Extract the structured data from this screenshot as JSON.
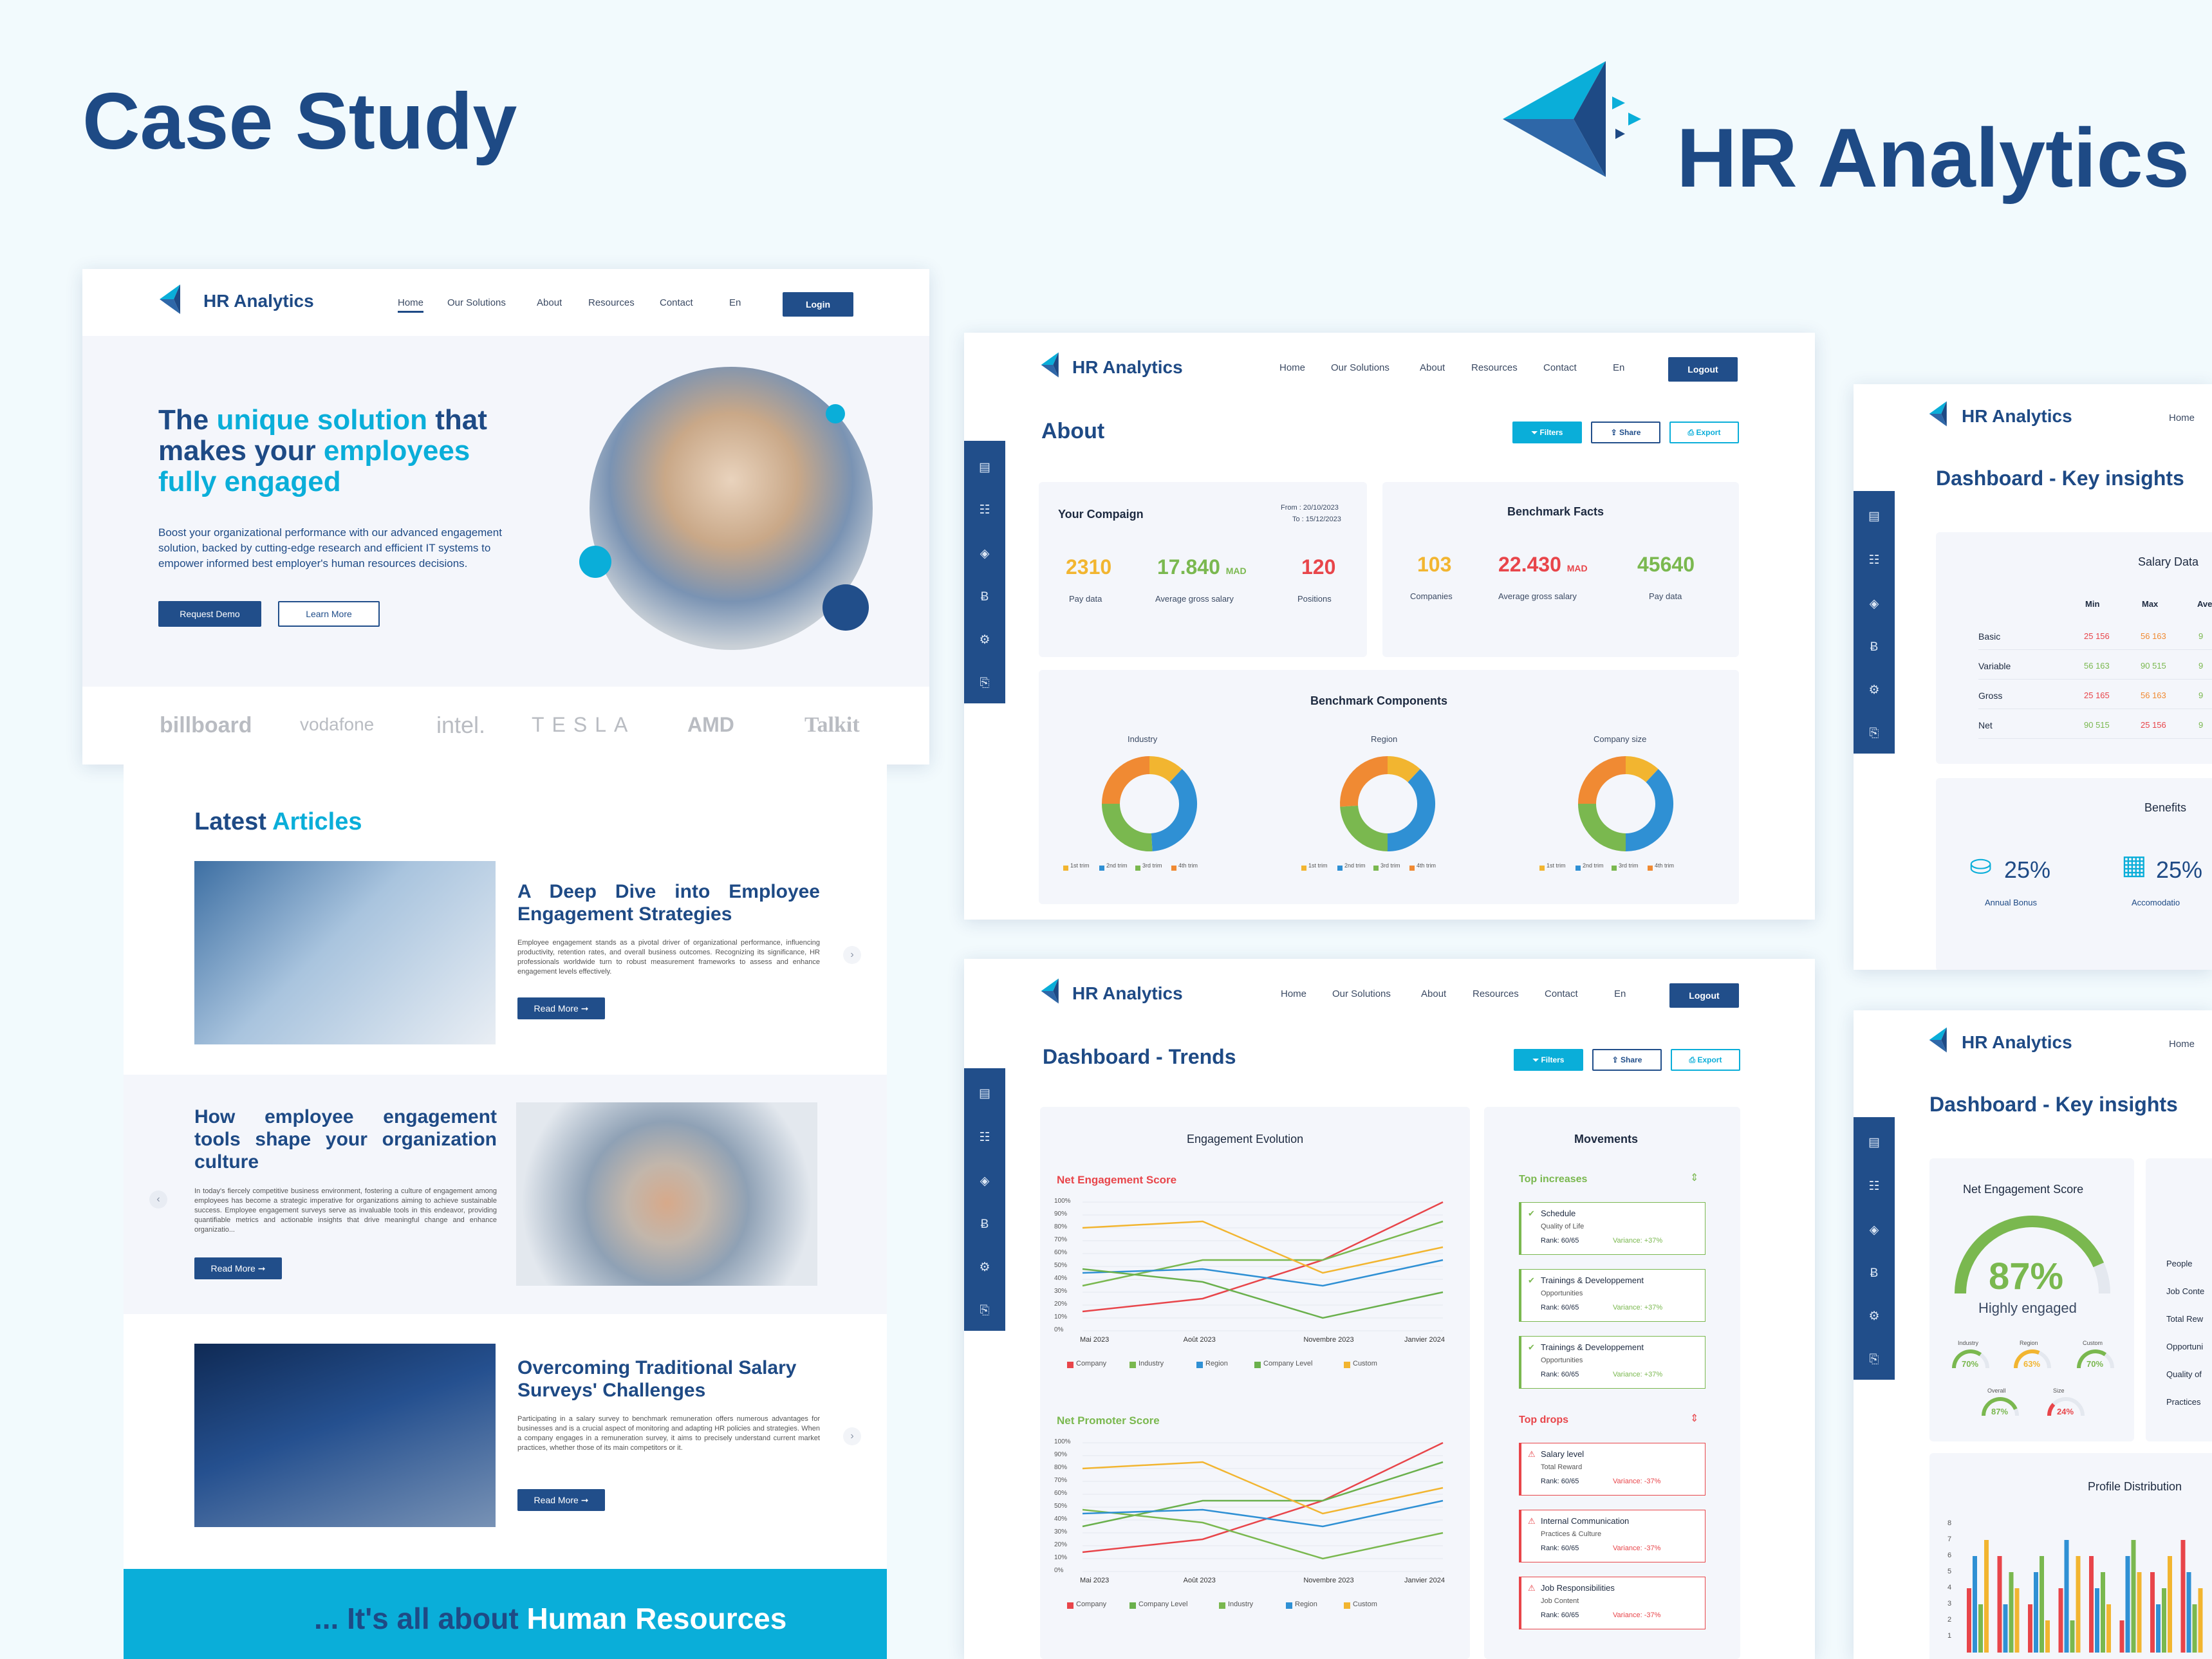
{
  "header": {
    "title": "Case Study",
    "brand": "HR Analytics"
  },
  "colors": {
    "navy": "#214e8a",
    "accent": "#0aaed9",
    "orange": "#f08a33",
    "green": "#7ab84f",
    "red": "#e8454a",
    "yellow": "#f2b530",
    "blue": "#2f90d4"
  },
  "nav": {
    "home": "Home",
    "solutions": "Our Solutions",
    "about": "About",
    "resources": "Resources",
    "contact": "Contact",
    "lang": "En",
    "login": "Login",
    "logout": "Logout"
  },
  "landing": {
    "hero_a": "The ",
    "hero_b": "unique solution",
    "hero_c": " that",
    "hero_d": "makes your ",
    "hero_e": "employees",
    "hero_f": "fully engaged",
    "hero_text": "Boost your organizational performance with our advanced engagement solution, backed by cutting-edge research and efficient IT systems to empower informed best employer's human resources decisions.",
    "request_demo": "Request Demo",
    "learn_more": "Learn More",
    "logos": [
      "billboard",
      "vodafone",
      "intel.",
      "TESLA",
      "AMD",
      "Talkit"
    ]
  },
  "articles": {
    "heading_a": "Latest ",
    "heading_b": "Articles",
    "read_more": "Read More",
    "items": [
      {
        "title": "A Deep Dive into Employee Engagement Strategies",
        "text": "Employee engagement stands as a pivotal driver of organizational performance, influencing productivity, retention rates, and overall business outcomes. Recognizing its significance, HR professionals worldwide turn to robust measurement frameworks to assess and enhance engagement levels effectively."
      },
      {
        "title": "How employee engagement tools shape your organization culture",
        "text": "In today's fiercely competitive business environment, fostering a culture of engagement among employees has become a strategic imperative for organizations aiming to achieve sustainable success. Employee engagement surveys serve as invaluable tools in this endeavor, providing quantifiable metrics and actionable insights that drive meaningful change and enhance organizatio..."
      },
      {
        "title": "Overcoming Traditional Salary Surveys' Challenges",
        "text": "Participating in a salary survey to benchmark remuneration offers numerous advantages for businesses and is a crucial aspect of monitoring and adapting HR policies and strategies. When a company engages in a remuneration survey, it aims to precisely understand current market practices, whether those of its main competitors or it."
      }
    ],
    "banner_a": "... It's all about ",
    "banner_b": "Human Resources"
  },
  "about_page": {
    "title": "About",
    "filters": "Filters",
    "share": "Share",
    "export": "Export",
    "campaign": {
      "label": "Your Compaign",
      "from": "From : 20/10/2023",
      "to": "To : 15/12/2023",
      "stats": [
        {
          "value": "2310",
          "unit": "",
          "label": "Pay data"
        },
        {
          "value": "17.840",
          "unit": "MAD",
          "label": "Average gross salary"
        },
        {
          "value": "120",
          "unit": "",
          "label": "Positions"
        }
      ]
    },
    "benchmark": {
      "label": "Benchmark Facts",
      "stats": [
        {
          "value": "103",
          "unit": "",
          "label": "Companies"
        },
        {
          "value": "22.430",
          "unit": "MAD",
          "label": "Average gross salary"
        },
        {
          "value": "45640",
          "unit": "",
          "label": "Pay data"
        }
      ]
    },
    "components": {
      "label": "Benchmark Components",
      "charts": [
        "Industry",
        "Region",
        "Company size"
      ],
      "legend": [
        "1st trim",
        "2nd trim",
        "3rd trim",
        "4th trim"
      ]
    }
  },
  "trends_page": {
    "title": "Dashboard - Trends",
    "engagement_title": "Engagement Evolution",
    "nes_title": "Net Engagement Score",
    "nps_title": "Net Promoter Score",
    "x_ticks": [
      "Mai 2023",
      "Août 2023",
      "Novembre 2023",
      "Janvier 2024"
    ],
    "y_ticks": [
      "100%",
      "90%",
      "80%",
      "70%",
      "60%",
      "50%",
      "40%",
      "30%",
      "20%",
      "10%",
      "0%"
    ],
    "legend1": [
      "Company",
      "Industry",
      "Region",
      "Company Level",
      "Custom"
    ],
    "legend2": [
      "Company",
      "Company Level",
      "Industry",
      "Region",
      "Custom"
    ],
    "movements": {
      "title": "Movements",
      "increases": "Top increases",
      "drops": "Top drops",
      "up": [
        {
          "name": "Schedule",
          "sub": "Quality of Life",
          "rank": "Rank: 60/65",
          "variance": "Variance: +37%"
        },
        {
          "name": "Trainings & Developpement",
          "sub": "Opportunities",
          "rank": "Rank: 60/65",
          "variance": "Variance: +37%"
        },
        {
          "name": "Trainings & Developpement",
          "sub": "Opportunities",
          "rank": "Rank: 60/65",
          "variance": "Variance: +37%"
        }
      ],
      "down": [
        {
          "name": "Salary level",
          "sub": "Total Reward",
          "rank": "Rank: 60/65",
          "variance": "Variance: -37%"
        },
        {
          "name": "Internal Communication",
          "sub": "Practices & Culture",
          "rank": "Rank: 60/65",
          "variance": "Variance: -37%"
        },
        {
          "name": "Job Responsibilities",
          "sub": "Job Content",
          "rank": "Rank: 60/65",
          "variance": "Variance: -37%"
        }
      ]
    }
  },
  "insights1": {
    "title": "Dashboard - Key insights",
    "home": "Home",
    "salary": {
      "label": "Salary Data",
      "cols": [
        "Min",
        "Max",
        "Ave"
      ],
      "rows": [
        {
          "name": "Basic",
          "min": "25 156",
          "max": "56 163",
          "ave": "9"
        },
        {
          "name": "Variable",
          "min": "56 163",
          "max": "90 515",
          "ave": "9"
        },
        {
          "name": "Gross",
          "min": "25 165",
          "max": "56 163",
          "ave": "9"
        },
        {
          "name": "Net",
          "min": "90 515",
          "max": "25 156",
          "ave": "9"
        }
      ]
    },
    "benefits": {
      "label": "Benefits",
      "items": [
        {
          "value": "25%",
          "label": "Annual Bonus"
        },
        {
          "value": "25%",
          "label": "Accomodatio"
        }
      ]
    }
  },
  "insights2": {
    "title": "Dashboard - Key insights",
    "home": "Home",
    "nes": {
      "label": "Net Engagement Score",
      "value": "87%",
      "sub": "Highly engaged",
      "main_pct": 87,
      "minis": [
        {
          "value": "70%",
          "label": "Industry",
          "pct": 70
        },
        {
          "value": "63%",
          "label": "Region",
          "pct": 63
        },
        {
          "value": "70%",
          "label": "Custom",
          "pct": 70
        },
        {
          "value": "87%",
          "label": "Overall",
          "pct": 87
        },
        {
          "value": "24%",
          "label": "Size",
          "pct": 24
        }
      ]
    },
    "list": [
      "People",
      "Job Conte",
      "Total Rew",
      "Opportuni",
      "Quality of",
      "Practices"
    ],
    "profile": {
      "label": "Profile Distribution",
      "y_ticks": [
        "8",
        "7",
        "6",
        "5",
        "4",
        "3",
        "2",
        "1"
      ]
    }
  },
  "chart_data": [
    {
      "type": "pie",
      "title": "Industry",
      "categories": [
        "1st trim",
        "2nd trim",
        "3rd trim",
        "4th trim"
      ],
      "values": [
        12,
        37,
        26,
        25
      ]
    },
    {
      "type": "pie",
      "title": "Region",
      "categories": [
        "1st trim",
        "2nd trim",
        "3rd trim",
        "4th trim"
      ],
      "values": [
        12,
        38,
        24,
        26
      ]
    },
    {
      "type": "pie",
      "title": "Company size",
      "categories": [
        "1st trim",
        "2nd trim",
        "3rd trim",
        "4th trim"
      ],
      "values": [
        12,
        38,
        25,
        25
      ]
    },
    {
      "type": "line",
      "title": "Net Engagement Score",
      "x": [
        "Mai 2023",
        "Août 2023",
        "Novembre 2023",
        "Janvier 2024"
      ],
      "ylim": [
        0,
        100
      ],
      "series": [
        {
          "name": "Company",
          "values": [
            15,
            25,
            55,
            100
          ]
        },
        {
          "name": "Industry",
          "values": [
            35,
            55,
            55,
            85
          ]
        },
        {
          "name": "Region",
          "values": [
            45,
            48,
            35,
            55
          ]
        },
        {
          "name": "Company Level",
          "values": [
            48,
            38,
            10,
            30
          ]
        },
        {
          "name": "Custom",
          "values": [
            80,
            85,
            45,
            65
          ]
        }
      ]
    },
    {
      "type": "line",
      "title": "Net Promoter Score",
      "x": [
        "Mai 2023",
        "Août 2023",
        "Novembre 2023",
        "Janvier 2024"
      ],
      "ylim": [
        0,
        100
      ],
      "series": [
        {
          "name": "Company",
          "values": [
            15,
            25,
            55,
            100
          ]
        },
        {
          "name": "Company Level",
          "values": [
            35,
            55,
            55,
            85
          ]
        },
        {
          "name": "Industry",
          "values": [
            48,
            38,
            10,
            30
          ]
        },
        {
          "name": "Region",
          "values": [
            45,
            48,
            35,
            55
          ]
        },
        {
          "name": "Custom",
          "values": [
            80,
            85,
            45,
            65
          ]
        }
      ]
    },
    {
      "type": "bar",
      "title": "Profile Distribution",
      "ylim": [
        0,
        8
      ],
      "series": [
        {
          "name": "red",
          "values": [
            4,
            6,
            3,
            4,
            6,
            2,
            5,
            7
          ]
        },
        {
          "name": "blue",
          "values": [
            6,
            3,
            5,
            7,
            4,
            6,
            3,
            5
          ]
        },
        {
          "name": "green",
          "values": [
            3,
            5,
            6,
            2,
            5,
            7,
            4,
            3
          ]
        },
        {
          "name": "yellow",
          "values": [
            7,
            4,
            2,
            6,
            3,
            5,
            6,
            4
          ]
        }
      ]
    }
  ]
}
